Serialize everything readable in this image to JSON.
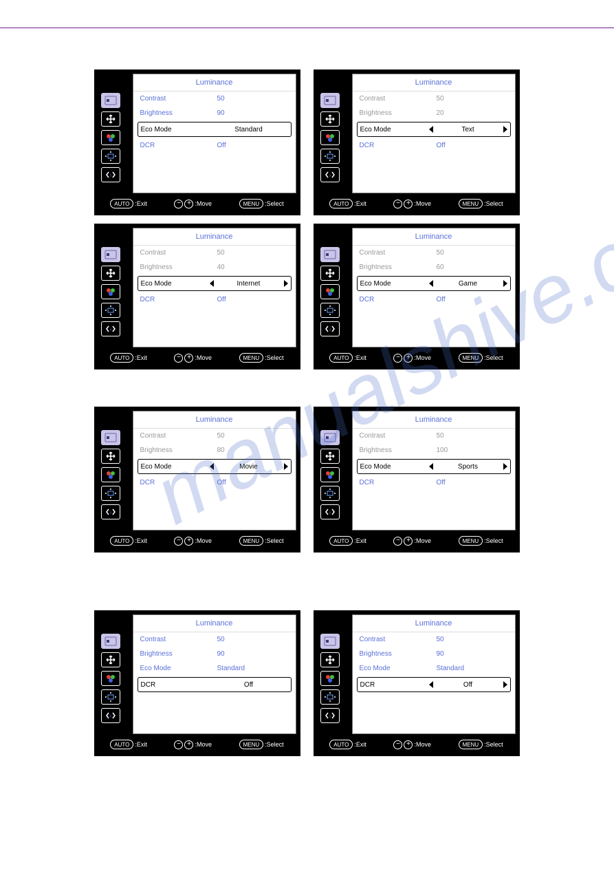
{
  "watermark": "manualshive.com",
  "footer_labels": {
    "exit": ":Exit",
    "move": ":Move",
    "select": ":Select",
    "auto": "AUTO",
    "menu": "MENU",
    "minus": "−",
    "plus": "+"
  },
  "panels": [
    {
      "title": "Luminance",
      "rows": [
        {
          "label": "Contrast",
          "value": "50",
          "style": "blue"
        },
        {
          "label": "Brightness",
          "value": "90",
          "style": "blue"
        },
        {
          "label": "Eco Mode",
          "value": "Standard",
          "style": "highlight",
          "arrows": false
        },
        {
          "label": "DCR",
          "value": "Off",
          "style": "blue"
        }
      ]
    },
    {
      "title": "Luminance",
      "rows": [
        {
          "label": "Contrast",
          "value": "50",
          "style": "grey"
        },
        {
          "label": "Brightness",
          "value": "20",
          "style": "grey"
        },
        {
          "label": "Eco Mode",
          "value": "Text",
          "style": "highlight",
          "arrows": true
        },
        {
          "label": "DCR",
          "value": "Off",
          "style": "blue"
        }
      ]
    },
    {
      "title": "Luminance",
      "rows": [
        {
          "label": "Contrast",
          "value": "50",
          "style": "grey"
        },
        {
          "label": "Brightness",
          "value": "40",
          "style": "grey"
        },
        {
          "label": "Eco Mode",
          "value": "Internet",
          "style": "highlight",
          "arrows": true
        },
        {
          "label": "DCR",
          "value": "Off",
          "style": "blue"
        }
      ]
    },
    {
      "title": "Luminance",
      "rows": [
        {
          "label": "Contrast",
          "value": "50",
          "style": "grey"
        },
        {
          "label": "Brightness",
          "value": "60",
          "style": "grey"
        },
        {
          "label": "Eco Mode",
          "value": "Game",
          "style": "highlight",
          "arrows": true
        },
        {
          "label": "DCR",
          "value": "Off",
          "style": "blue"
        }
      ]
    },
    {
      "title": "Luminance",
      "rows": [
        {
          "label": "Contrast",
          "value": "50",
          "style": "grey"
        },
        {
          "label": "Brightness",
          "value": "80",
          "style": "grey"
        },
        {
          "label": "Eco Mode",
          "value": "Movie",
          "style": "highlight",
          "arrows": true
        },
        {
          "label": "DCR",
          "value": "Off",
          "style": "blue"
        }
      ]
    },
    {
      "title": "Luminance",
      "rows": [
        {
          "label": "Contrast",
          "value": "50",
          "style": "grey"
        },
        {
          "label": "Brightness",
          "value": "100",
          "style": "grey"
        },
        {
          "label": "Eco Mode",
          "value": "Sports",
          "style": "highlight",
          "arrows": true
        },
        {
          "label": "DCR",
          "value": "Off",
          "style": "blue"
        }
      ]
    },
    {
      "title": "Luminance",
      "rows": [
        {
          "label": "Contrast",
          "value": "50",
          "style": "blue"
        },
        {
          "label": "Brightness",
          "value": "90",
          "style": "blue"
        },
        {
          "label": "Eco Mode",
          "value": "Standard",
          "style": "blue"
        },
        {
          "label": "DCR",
          "value": "Off",
          "style": "highlight",
          "arrows": false
        }
      ]
    },
    {
      "title": "Luminance",
      "rows": [
        {
          "label": "Contrast",
          "value": "50",
          "style": "blue"
        },
        {
          "label": "Brightness",
          "value": "90",
          "style": "blue"
        },
        {
          "label": "Eco Mode",
          "value": "Standard",
          "style": "blue"
        },
        {
          "label": "DCR",
          "value": "Off",
          "style": "highlight",
          "arrows": true
        }
      ]
    }
  ]
}
